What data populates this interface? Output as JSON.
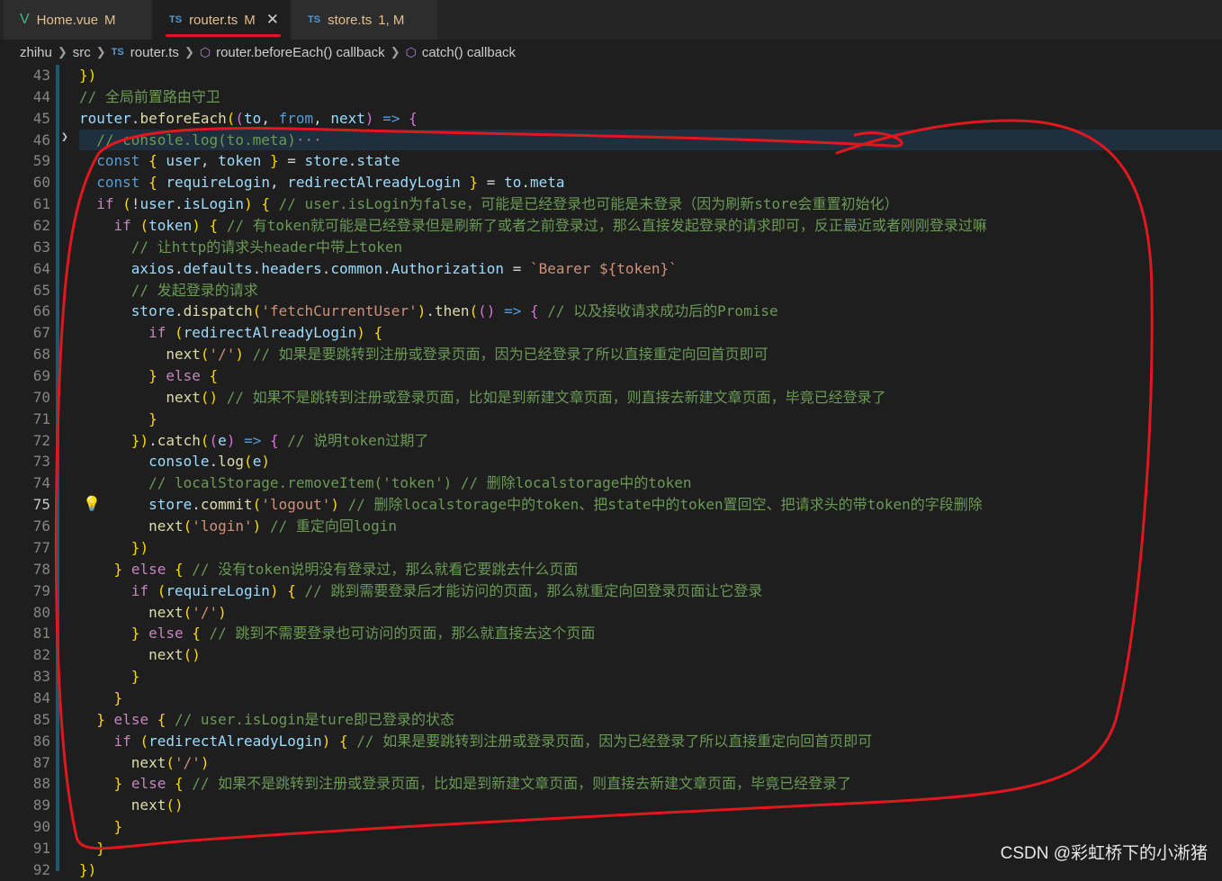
{
  "tabs": [
    {
      "icon": "V",
      "label": "Home.vue",
      "status": "M"
    },
    {
      "icon": "TS",
      "label": "router.ts",
      "status": "M",
      "close": "✕"
    },
    {
      "icon": "TS",
      "label": "store.ts",
      "status": "1, M"
    }
  ],
  "breadcrumb": {
    "folder": "zhihu",
    "sub": "src",
    "ts": "TS",
    "file": "router.ts",
    "symbol1": "router.beforeEach() callback",
    "symbol2": "catch() callback"
  },
  "lines": [
    {
      "n": "43",
      "t": "})"
    },
    {
      "n": "44",
      "t": "// 全局前置路由守卫"
    },
    {
      "n": "45",
      "t": "router.beforeEach((to, from, next) => {"
    },
    {
      "n": "46",
      "t": "  // console.log(to.meta)···"
    },
    {
      "n": "59",
      "t": "  const { user, token } = store.state"
    },
    {
      "n": "60",
      "t": "  const { requireLogin, redirectAlreadyLogin } = to.meta"
    },
    {
      "n": "61",
      "t": "  if (!user.isLogin) { // user.isLogin为false，可能是已经登录也可能是未登录（因为刷新store会重置初始化）"
    },
    {
      "n": "62",
      "t": "    if (token) { // 有token就可能是已经登录但是刷新了或者之前登录过，那么直接发起登录的请求即可，反正最近或者刚刚登录过嘛"
    },
    {
      "n": "63",
      "t": "      // 让http的请求头header中带上token"
    },
    {
      "n": "64",
      "t": "      axios.defaults.headers.common.Authorization = `Bearer ${token}`"
    },
    {
      "n": "65",
      "t": "      // 发起登录的请求"
    },
    {
      "n": "66",
      "t": "      store.dispatch('fetchCurrentUser').then(() => { // 以及接收请求成功后的Promise"
    },
    {
      "n": "67",
      "t": "        if (redirectAlreadyLogin) {"
    },
    {
      "n": "68",
      "t": "          next('/') // 如果是要跳转到注册或登录页面，因为已经登录了所以直接重定向回首页即可"
    },
    {
      "n": "69",
      "t": "        } else {"
    },
    {
      "n": "70",
      "t": "          next() // 如果不是跳转到注册或登录页面，比如是到新建文章页面，则直接去新建文章页面，毕竟已经登录了"
    },
    {
      "n": "71",
      "t": "        }"
    },
    {
      "n": "72",
      "t": "      }).catch((e) => { // 说明token过期了"
    },
    {
      "n": "73",
      "t": "        console.log(e)"
    },
    {
      "n": "74",
      "t": "        // localStorage.removeItem('token') // 删除localstorage中的token"
    },
    {
      "n": "75",
      "t": "        store.commit('logout') // 删除localstorage中的token、把state中的token置回空、把请求头的带token的字段删除"
    },
    {
      "n": "76",
      "t": "        next('login') // 重定向回login"
    },
    {
      "n": "77",
      "t": "      })"
    },
    {
      "n": "78",
      "t": "    } else { // 没有token说明没有登录过，那么就看它要跳去什么页面"
    },
    {
      "n": "79",
      "t": "      if (requireLogin) { // 跳到需要登录后才能访问的页面，那么就重定向回登录页面让它登录"
    },
    {
      "n": "80",
      "t": "        next('/')"
    },
    {
      "n": "81",
      "t": "      } else { // 跳到不需要登录也可访问的页面，那么就直接去这个页面"
    },
    {
      "n": "82",
      "t": "        next()"
    },
    {
      "n": "83",
      "t": "      }"
    },
    {
      "n": "84",
      "t": "    }"
    },
    {
      "n": "85",
      "t": "  } else { // user.isLogin是ture即已登录的状态"
    },
    {
      "n": "86",
      "t": "    if (redirectAlreadyLogin) { // 如果是要跳转到注册或登录页面，因为已经登录了所以直接重定向回首页即可"
    },
    {
      "n": "87",
      "t": "      next('/')"
    },
    {
      "n": "88",
      "t": "    } else { // 如果不是跳转到注册或登录页面，比如是到新建文章页面，则直接去新建文章页面，毕竟已经登录了"
    },
    {
      "n": "89",
      "t": "      next()"
    },
    {
      "n": "90",
      "t": "    }"
    },
    {
      "n": "91",
      "t": "  }"
    },
    {
      "n": "92",
      "t": "})"
    }
  ],
  "current_line": "75",
  "watermark": "CSDN @彩虹桥下的小淅猪",
  "colors": {
    "keyword": "#569cd6",
    "control": "#c586c0",
    "variable": "#9cdcfe",
    "function": "#dcdcaa",
    "string": "#ce9178",
    "comment": "#6a9955",
    "annotation": "#e0181e"
  }
}
